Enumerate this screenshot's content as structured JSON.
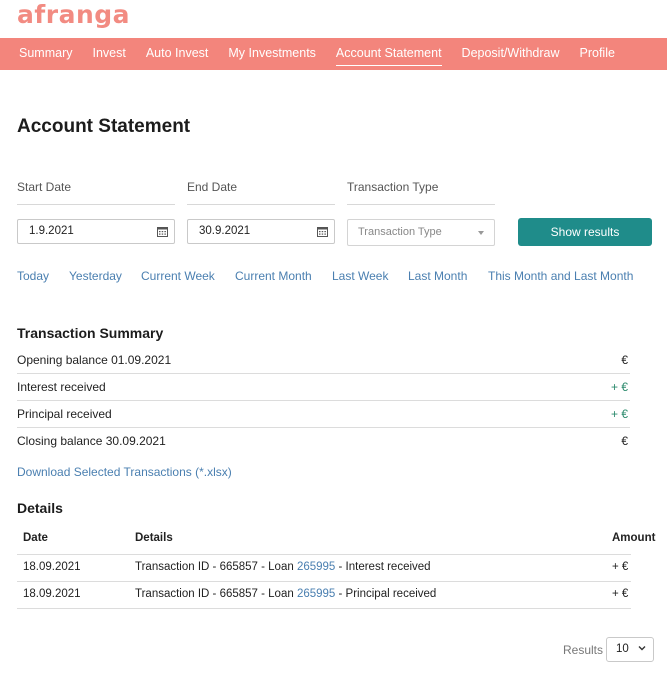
{
  "brand": {
    "name": "afranga",
    "color": "#f28b82"
  },
  "nav": {
    "color": "#f3857c",
    "items": [
      {
        "label": "Summary"
      },
      {
        "label": "Invest"
      },
      {
        "label": "Auto Invest"
      },
      {
        "label": "My Investments"
      },
      {
        "label": "Account Statement",
        "active": true
      },
      {
        "label": "Deposit/Withdraw"
      },
      {
        "label": "Profile"
      }
    ]
  },
  "page": {
    "title": "Account Statement"
  },
  "filters": {
    "start_label": "Start Date",
    "start_value": "1.9.2021",
    "end_label": "End Date",
    "end_value": "30.9.2021",
    "type_label": "Transaction Type",
    "type_placeholder": "Transaction Type",
    "show_button": "Show results",
    "button_color": "#1f8c8a",
    "quick_ranges": [
      "Today",
      "Yesterday",
      "Current Week",
      "Current Month",
      "Last Week",
      "Last Month",
      "This Month and Last Month"
    ]
  },
  "summary": {
    "title": "Transaction Summary",
    "rows": [
      {
        "label": "Opening balance 01.09.2021",
        "value": "€"
      },
      {
        "label": "Interest received",
        "value": "+ €"
      },
      {
        "label": "Principal received",
        "value": "+ €"
      },
      {
        "label": "Closing balance 30.09.2021",
        "value": "€"
      }
    ],
    "download_label": "Download Selected Transactions (*.xlsx)"
  },
  "details": {
    "title": "Details",
    "columns": [
      "Date",
      "Details",
      "Amount"
    ],
    "rows": [
      {
        "date": "18.09.2021",
        "prefix": "Transaction ID - 665857 - Loan ",
        "loan": "265995",
        "suffix": " - Interest received",
        "amount": "+ €"
      },
      {
        "date": "18.09.2021",
        "prefix": "Transaction ID - 665857 - Loan ",
        "loan": "265995",
        "suffix": " - Principal received",
        "amount": "+ €"
      }
    ]
  },
  "pagination": {
    "results_label": "Results",
    "per_page": "10"
  }
}
